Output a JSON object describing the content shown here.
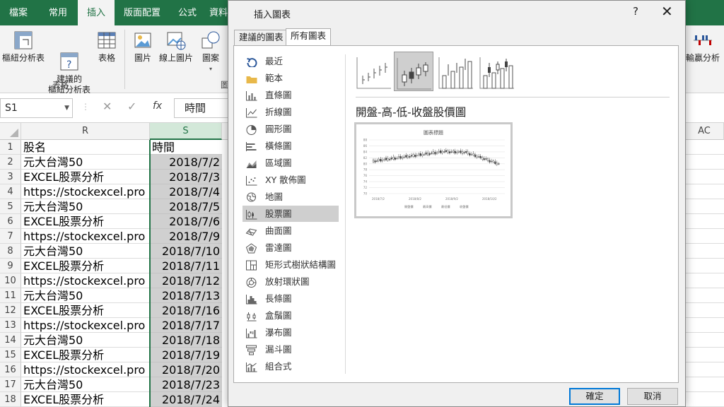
{
  "ribbon": {
    "tabs": [
      "檔案",
      "常用",
      "插入",
      "版面配置",
      "公式",
      "資料"
    ],
    "active_tab": "插入",
    "buttons": {
      "pivot": "樞紐分析表",
      "recommended_pivot": "建議的\n樞紐分析表",
      "table": "表格",
      "picture": "圖片",
      "online_picture": "線上圖片",
      "shapes": "圖案",
      "win_loss": "輸贏分析"
    },
    "group_table": "表格",
    "group_partial": "圖"
  },
  "formula_bar": {
    "name_box": "S1",
    "content": "時間"
  },
  "columns": {
    "r": "R",
    "s": "S",
    "ac": "AC"
  },
  "rows": [
    {
      "n": "1",
      "r": "股名",
      "s": "時間"
    },
    {
      "n": "2",
      "r": "元大台灣50",
      "s": "2018/7/2"
    },
    {
      "n": "3",
      "r": "EXCEL股票分析",
      "s": "2018/7/3"
    },
    {
      "n": "4",
      "r": "https://stockexcel.pro",
      "s": "2018/7/4"
    },
    {
      "n": "5",
      "r": "元大台灣50",
      "s": "2018/7/5"
    },
    {
      "n": "6",
      "r": "EXCEL股票分析",
      "s": "2018/7/6"
    },
    {
      "n": "7",
      "r": "https://stockexcel.pro",
      "s": "2018/7/9"
    },
    {
      "n": "8",
      "r": "元大台灣50",
      "s": "2018/7/10"
    },
    {
      "n": "9",
      "r": "EXCEL股票分析",
      "s": "2018/7/11"
    },
    {
      "n": "10",
      "r": "https://stockexcel.pro",
      "s": "2018/7/12"
    },
    {
      "n": "11",
      "r": "元大台灣50",
      "s": "2018/7/13"
    },
    {
      "n": "12",
      "r": "EXCEL股票分析",
      "s": "2018/7/16"
    },
    {
      "n": "13",
      "r": "https://stockexcel.pro",
      "s": "2018/7/17"
    },
    {
      "n": "14",
      "r": "元大台灣50",
      "s": "2018/7/18"
    },
    {
      "n": "15",
      "r": "EXCEL股票分析",
      "s": "2018/7/19"
    },
    {
      "n": "16",
      "r": "https://stockexcel.pro",
      "s": "2018/7/20"
    },
    {
      "n": "17",
      "r": "元大台灣50",
      "s": "2018/7/23"
    },
    {
      "n": "18",
      "r": "EXCEL股票分析",
      "s": "2018/7/24"
    }
  ],
  "dialog": {
    "title": "插入圖表",
    "help": "?",
    "close": "✕",
    "tabs": [
      "建議的圖表",
      "所有圖表"
    ],
    "active_tab": "所有圖表",
    "categories": [
      {
        "label": "最近",
        "icon": "recent-icon"
      },
      {
        "label": "範本",
        "icon": "templates-folder-icon"
      },
      {
        "label": "直條圖",
        "icon": "column-chart-icon"
      },
      {
        "label": "折線圖",
        "icon": "line-chart-icon"
      },
      {
        "label": "圓形圖",
        "icon": "pie-chart-icon"
      },
      {
        "label": "橫條圖",
        "icon": "bar-chart-icon"
      },
      {
        "label": "區域圖",
        "icon": "area-chart-icon"
      },
      {
        "label": "XY 散佈圖",
        "icon": "scatter-chart-icon"
      },
      {
        "label": "地圖",
        "icon": "map-chart-icon"
      },
      {
        "label": "股票圖",
        "icon": "stock-chart-icon"
      },
      {
        "label": "曲面圖",
        "icon": "surface-chart-icon"
      },
      {
        "label": "雷達圖",
        "icon": "radar-chart-icon"
      },
      {
        "label": "矩形式樹狀結構圖",
        "icon": "treemap-chart-icon"
      },
      {
        "label": "放射環狀圖",
        "icon": "sunburst-chart-icon"
      },
      {
        "label": "長條圖",
        "icon": "histogram-chart-icon"
      },
      {
        "label": "盒鬚圖",
        "icon": "box-whisker-chart-icon"
      },
      {
        "label": "瀑布圖",
        "icon": "waterfall-chart-icon"
      },
      {
        "label": "漏斗圖",
        "icon": "funnel-chart-icon"
      },
      {
        "label": "組合式",
        "icon": "combo-chart-icon"
      }
    ],
    "selected_category": "股票圖",
    "subtypes": [
      "high-low-close",
      "open-high-low-close",
      "volume-high-low-close",
      "volume-open-high-low-close"
    ],
    "selected_subtype": "open-high-low-close",
    "subtype_name": "開盤-高-低-收盤股價圖",
    "preview": {
      "title": "圖表標題",
      "y_ticks": [
        "88",
        "86",
        "84",
        "82",
        "80",
        "78",
        "76",
        "74",
        "72",
        "70"
      ],
      "x_ticks": [
        "2018/7/2",
        "2018/8/2",
        "2018/9/2",
        "2018/10/2"
      ],
      "legend": [
        "開盤價",
        "最高價",
        "最低價",
        "收盤價"
      ]
    },
    "ok": "確定",
    "cancel": "取消"
  },
  "colors": {
    "excel_green": "#217346",
    "selection_gray": "#cfcfcf",
    "primary_border": "#0078d7"
  }
}
